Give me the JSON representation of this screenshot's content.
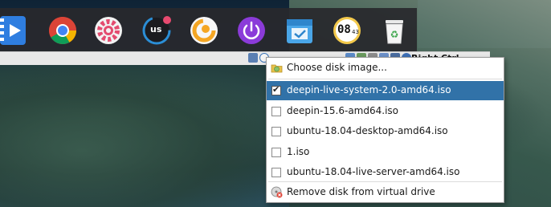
{
  "status_bar": {
    "text": "Right Ctrl"
  },
  "menu": {
    "choose": "Choose disk image...",
    "items": [
      {
        "label": "deepin-live-system-2.0-amd64.iso",
        "checked": true
      },
      {
        "label": "deepin-15.6-amd64.iso",
        "checked": false
      },
      {
        "label": "ubuntu-18.04-desktop-amd64.iso",
        "checked": false
      },
      {
        "label": "1.iso",
        "checked": false
      },
      {
        "label": "ubuntu-18.04-live-server-amd64.iso",
        "checked": false
      }
    ],
    "remove": "Remove disk from virtual drive"
  },
  "dock": {
    "clock_hour": "08",
    "clock_min": "43",
    "us_label": "us"
  },
  "colors": {
    "menu_highlight": "#3172a8",
    "dock_bg": "#28282c"
  }
}
